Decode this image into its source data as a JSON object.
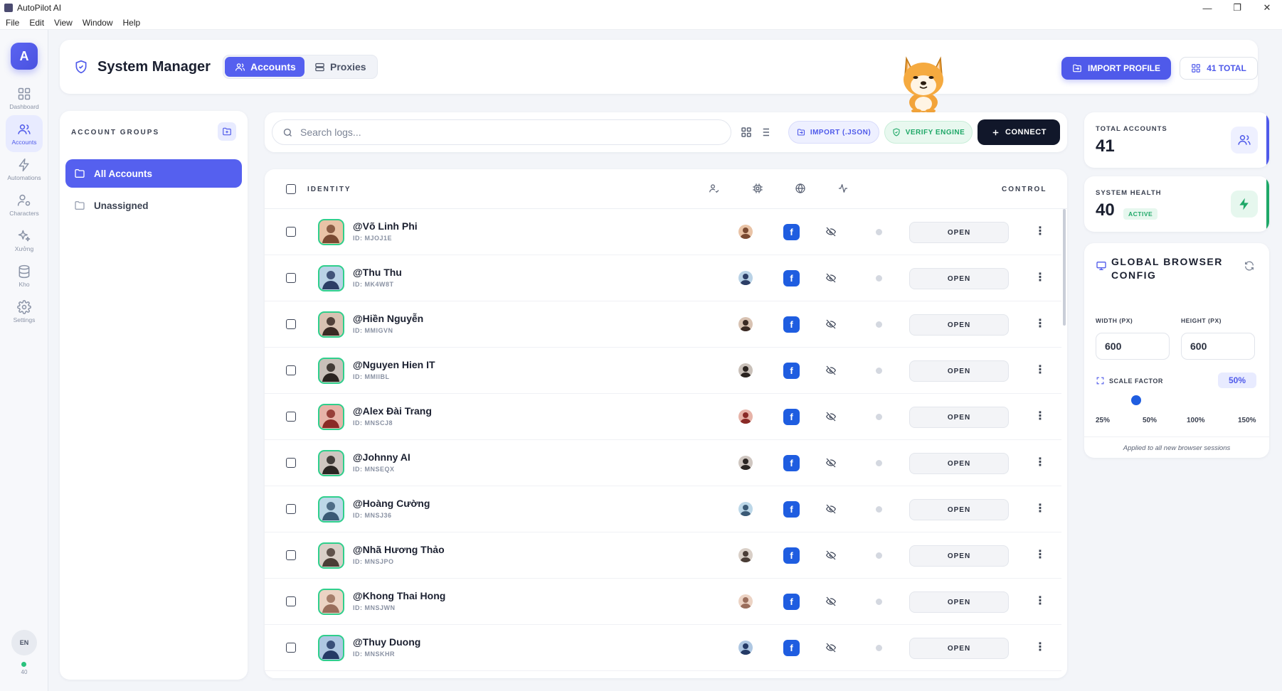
{
  "window": {
    "title": "AutoPilot AI",
    "minimize": "—",
    "maximize": "❐",
    "close": "✕"
  },
  "menu": [
    "File",
    "Edit",
    "View",
    "Window",
    "Help"
  ],
  "sidebar": {
    "logo": "A",
    "items": [
      {
        "label": "Dashboard",
        "icon": "dashboard-icon",
        "active": false
      },
      {
        "label": "Accounts",
        "icon": "users-icon",
        "active": true
      },
      {
        "label": "Automations",
        "icon": "bolt-icon",
        "active": false
      },
      {
        "label": "Characters",
        "icon": "characters-icon",
        "active": false
      },
      {
        "label": "Xưởng",
        "icon": "sparkles-icon",
        "active": false
      },
      {
        "label": "Kho",
        "icon": "database-icon",
        "active": false
      },
      {
        "label": "Settings",
        "icon": "gear-icon",
        "active": false
      }
    ],
    "language": "EN",
    "status_count": "40"
  },
  "header": {
    "title": "System Manager",
    "tabs": [
      {
        "label": "Accounts",
        "active": true
      },
      {
        "label": "Proxies",
        "active": false
      }
    ],
    "import_profile": "IMPORT PROFILE",
    "total": "41 TOTAL"
  },
  "groups": {
    "title": "ACCOUNT GROUPS",
    "items": [
      {
        "label": "All Accounts",
        "active": true
      },
      {
        "label": "Unassigned",
        "active": false
      }
    ]
  },
  "toolbar": {
    "search_placeholder": "Search logs...",
    "import_json": "IMPORT (.JSON)",
    "verify_engine": "VERIFY ENGINE",
    "connect": "CONNECT"
  },
  "table": {
    "col_identity": "IDENTITY",
    "col_control": "CONTROL",
    "open_label": "OPEN",
    "fb_glyph": "f",
    "rows": [
      {
        "name": "@Võ Linh Phi",
        "id": "ID: MJOJ1E"
      },
      {
        "name": "@Thu Thu",
        "id": "ID: MK4W8T"
      },
      {
        "name": "@Hiền Nguyễn",
        "id": "ID: MMIGVN"
      },
      {
        "name": "@Nguyen Hien IT",
        "id": "ID: MMIIBL"
      },
      {
        "name": "@Alex Đài Trang",
        "id": "ID: MNSCJ8"
      },
      {
        "name": "@Johnny AI",
        "id": "ID: MNSEQX"
      },
      {
        "name": "@Hoàng Cường",
        "id": "ID: MNSJ36"
      },
      {
        "name": "@Nhã Hương Thảo",
        "id": "ID: MNSJPO"
      },
      {
        "name": "@Khong Thai Hong",
        "id": "ID: MNSJWN"
      },
      {
        "name": "@Thuy Duong",
        "id": "ID: MNSKHR"
      }
    ]
  },
  "stats": {
    "total_accounts": {
      "label": "TOTAL ACCOUNTS",
      "value": "41"
    },
    "system_health": {
      "label": "SYSTEM HEALTH",
      "value": "40",
      "badge": "ACTIVE"
    }
  },
  "browser_config": {
    "title": "GLOBAL BROWSER CONFIG",
    "width_label": "WIDTH (PX)",
    "width_value": "600",
    "height_label": "HEIGHT (PX)",
    "height_value": "600",
    "scale_label": "SCALE FACTOR",
    "scale_value": "50%",
    "scale_fraction": 0.25,
    "ticks": [
      "25%",
      "50%",
      "100%",
      "150%"
    ],
    "note": "Applied to all new browser sessions"
  },
  "colors": {
    "accent": "#5560ef",
    "facebook": "#1f5de0",
    "success": "#1fa868",
    "avatar_ring": "#2fcf8c"
  }
}
